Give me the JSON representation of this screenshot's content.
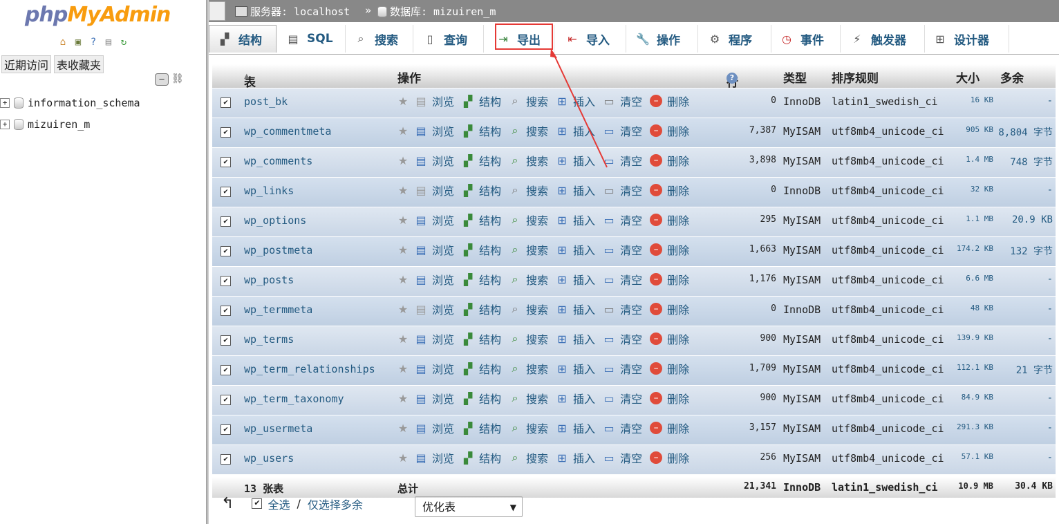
{
  "sidebar": {
    "logo_php": "php",
    "logo_myadmin": "MyAdmin",
    "tabs": [
      "近期访问",
      "表收藏夹"
    ],
    "databases": [
      "information_schema",
      "mizuiren_m"
    ]
  },
  "breadcrumb": {
    "server_label": "服务器: localhost",
    "separator": "»",
    "database_label": "数据库: mizuiren_m"
  },
  "tabs": [
    {
      "label": "结构",
      "icon": "structure-icon"
    },
    {
      "label": "SQL",
      "icon": "sql-icon"
    },
    {
      "label": "搜索",
      "icon": "search-icon"
    },
    {
      "label": "查询",
      "icon": "query-icon"
    },
    {
      "label": "导出",
      "icon": "export-icon"
    },
    {
      "label": "导入",
      "icon": "import-icon"
    },
    {
      "label": "操作",
      "icon": "wrench-icon"
    },
    {
      "label": "程序",
      "icon": "routines-icon"
    },
    {
      "label": "事件",
      "icon": "clock-icon"
    },
    {
      "label": "触发器",
      "icon": "trigger-icon"
    },
    {
      "label": "设计器",
      "icon": "designer-icon"
    }
  ],
  "table": {
    "headers": {
      "table": "表",
      "sort_mark": "▲",
      "actions": "操作",
      "rows": "行数",
      "type": "类型",
      "collation": "排序规则",
      "size": "大小",
      "overhead": "多余"
    },
    "action_labels": {
      "browse": "浏览",
      "structure": "结构",
      "search": "搜索",
      "insert": "插入",
      "empty": "清空",
      "drop": "删除"
    },
    "rows": [
      {
        "name": "post_bk",
        "rows": "0",
        "type": "InnoDB",
        "collation": "latin1_swedish_ci",
        "size": "16 KB",
        "overhead": "-"
      },
      {
        "name": "wp_commentmeta",
        "rows": "7,387",
        "type": "MyISAM",
        "collation": "utf8mb4_unicode_ci",
        "size": "905 KB",
        "overhead": "8,804 字节"
      },
      {
        "name": "wp_comments",
        "rows": "3,898",
        "type": "MyISAM",
        "collation": "utf8mb4_unicode_ci",
        "size": "1.4 MB",
        "overhead": "748 字节"
      },
      {
        "name": "wp_links",
        "rows": "0",
        "type": "InnoDB",
        "collation": "utf8mb4_unicode_ci",
        "size": "32 KB",
        "overhead": "-"
      },
      {
        "name": "wp_options",
        "rows": "295",
        "type": "MyISAM",
        "collation": "utf8mb4_unicode_ci",
        "size": "1.1 MB",
        "overhead": "20.9 KB"
      },
      {
        "name": "wp_postmeta",
        "rows": "1,663",
        "type": "MyISAM",
        "collation": "utf8mb4_unicode_ci",
        "size": "174.2 KB",
        "overhead": "132 字节"
      },
      {
        "name": "wp_posts",
        "rows": "1,176",
        "type": "MyISAM",
        "collation": "utf8mb4_unicode_ci",
        "size": "6.6 MB",
        "overhead": "-"
      },
      {
        "name": "wp_termmeta",
        "rows": "0",
        "type": "InnoDB",
        "collation": "utf8mb4_unicode_ci",
        "size": "48 KB",
        "overhead": "-"
      },
      {
        "name": "wp_terms",
        "rows": "900",
        "type": "MyISAM",
        "collation": "utf8mb4_unicode_ci",
        "size": "139.9 KB",
        "overhead": "-"
      },
      {
        "name": "wp_term_relationships",
        "rows": "1,709",
        "type": "MyISAM",
        "collation": "utf8mb4_unicode_ci",
        "size": "112.1 KB",
        "overhead": "21 字节"
      },
      {
        "name": "wp_term_taxonomy",
        "rows": "900",
        "type": "MyISAM",
        "collation": "utf8mb4_unicode_ci",
        "size": "84.9 KB",
        "overhead": "-"
      },
      {
        "name": "wp_usermeta",
        "rows": "3,157",
        "type": "MyISAM",
        "collation": "utf8mb4_unicode_ci",
        "size": "291.3 KB",
        "overhead": "-"
      },
      {
        "name": "wp_users",
        "rows": "256",
        "type": "MyISAM",
        "collation": "utf8mb4_unicode_ci",
        "size": "57.1 KB",
        "overhead": "-"
      }
    ],
    "summary": {
      "count": "13 张表",
      "label": "总计",
      "rows": "21,341",
      "type": "InnoDB",
      "collation": "latin1_swedish_ci",
      "size": "10.9 MB",
      "overhead": "30.4 KB"
    }
  },
  "footer": {
    "check_all": "全选",
    "slash": "/",
    "check_overhead": "仅选择多余",
    "action_select": "优化表"
  },
  "colors": {
    "link": "#235a81",
    "highlight": "#e53935"
  }
}
